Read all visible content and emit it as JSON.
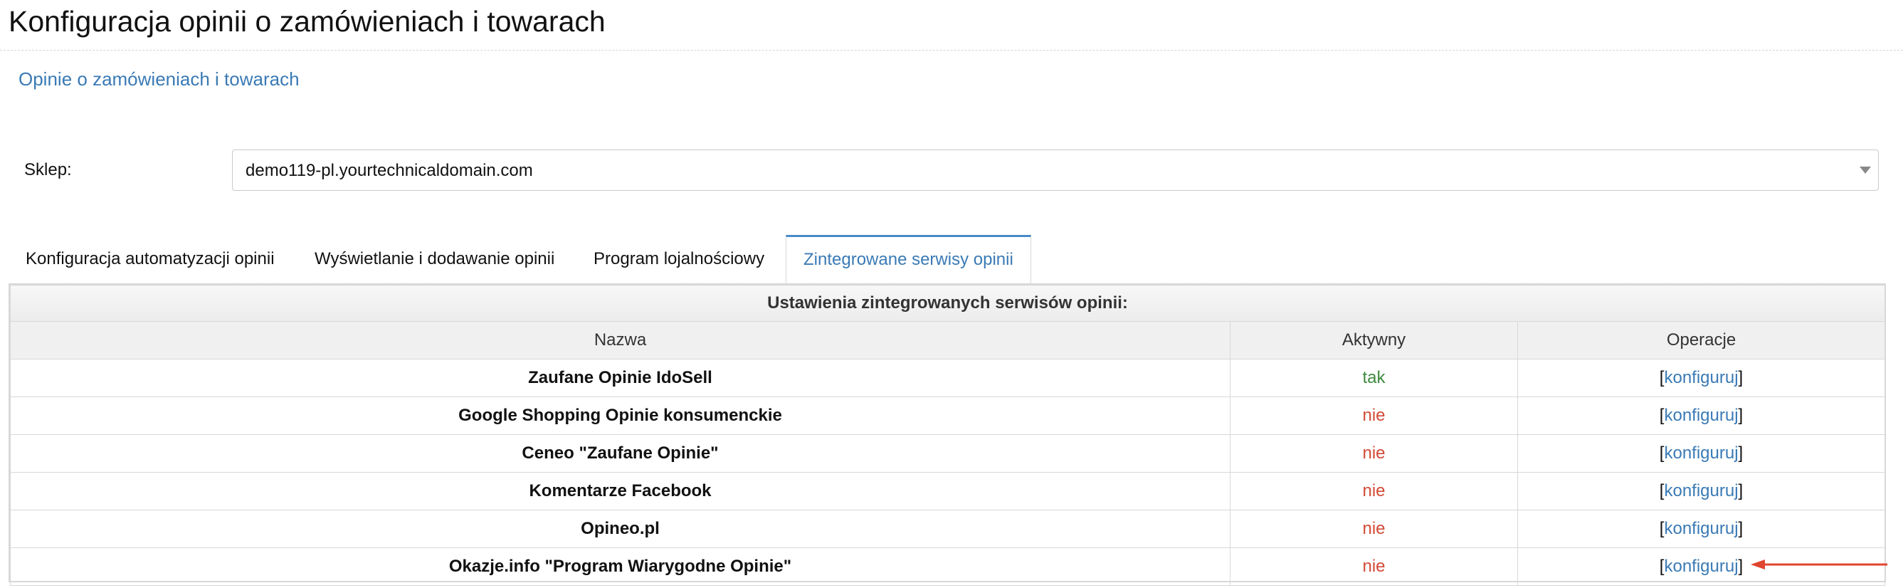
{
  "page_title": "Konfiguracja opinii o zamówieniach i towarach",
  "breadcrumb": "Opinie o zamówieniach i towarach",
  "shop": {
    "label": "Sklep:",
    "value": "demo119-pl.yourtechnicaldomain.com"
  },
  "tabs": [
    {
      "label": "Konfiguracja automatyzacji opinii",
      "active": false
    },
    {
      "label": "Wyświetlanie i dodawanie opinii",
      "active": false
    },
    {
      "label": "Program lojalnościowy",
      "active": false
    },
    {
      "label": "Zintegrowane serwisy opinii",
      "active": true
    }
  ],
  "table": {
    "caption": "Ustawienia zintegrowanych serwisów opinii:",
    "headers": {
      "name": "Nazwa",
      "active": "Aktywny",
      "operations": "Operacje"
    },
    "rows": [
      {
        "name": "Zaufane Opinie IdoSell",
        "active": "tak",
        "action": "konfiguruj"
      },
      {
        "name": "Google Shopping Opinie konsumenckie",
        "active": "nie",
        "action": "konfiguruj"
      },
      {
        "name": "Ceneo \"Zaufane Opinie\"",
        "active": "nie",
        "action": "konfiguruj"
      },
      {
        "name": "Komentarze Facebook",
        "active": "nie",
        "action": "konfiguruj"
      },
      {
        "name": "Opineo.pl",
        "active": "nie",
        "action": "konfiguruj"
      },
      {
        "name": "Okazje.info \"Program Wiarygodne Opinie\"",
        "active": "nie",
        "action": "konfiguruj"
      }
    ]
  },
  "colors": {
    "link": "#3a7ab5",
    "active_yes": "#3d8a3d",
    "active_no": "#d24a36",
    "annotation_arrow": "#e0452f",
    "tab_accent": "#4a8ac9"
  }
}
